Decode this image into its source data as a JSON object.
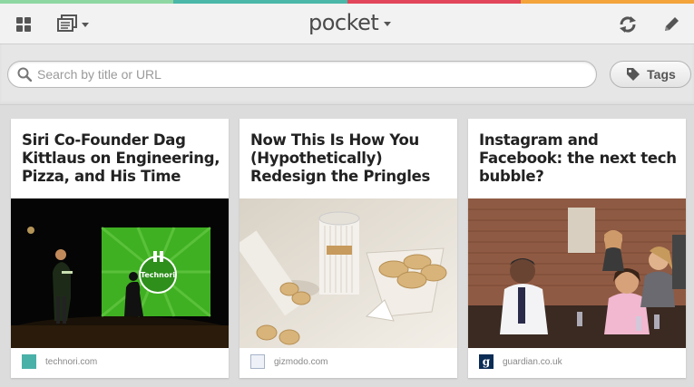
{
  "colors": {
    "stripe": [
      "#8ed7a2",
      "#4ab7a8",
      "#e2465a",
      "#f3a43b"
    ],
    "topbar_bg": "#f2f2f2",
    "icon": "#4d4d4d"
  },
  "toolbar": {
    "grid_icon": "grid-icon",
    "list_icon": "list-view-icon",
    "logo": "pocket",
    "sync_icon": "sync-icon",
    "edit_icon": "pencil-icon"
  },
  "search": {
    "placeholder": "Search by title or URL",
    "value": ""
  },
  "tags": {
    "label": "Tags"
  },
  "cards": [
    {
      "title": "Siri Co-Founder Dag Kittlaus on Engineering, Pizza, and His Time",
      "source": "technori.com",
      "image_text": "Technori"
    },
    {
      "title": "Now This Is How You (Hypothetically) Redesign the Pringles",
      "source": "gizmodo.com"
    },
    {
      "title": "Instagram and Facebook: the next tech bubble?",
      "source": "guardian.co.uk"
    }
  ]
}
